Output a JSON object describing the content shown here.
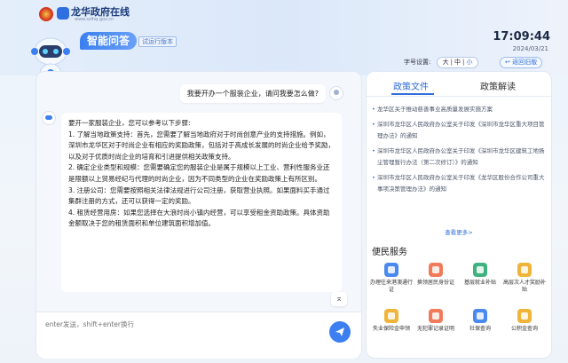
{
  "header": {
    "site_name": "龙华政府在线",
    "site_url": "www.szlhq.gov.cn",
    "app_title": "智能问答",
    "beta_tag": "试运行版本",
    "time": "17:09:44",
    "date": "2024/03/21",
    "font_size": {
      "label": "字号设置:",
      "options": [
        "大",
        "中",
        "小"
      ],
      "selected": "小"
    },
    "back_label": "↩ 返回旧版"
  },
  "chat": {
    "user_message": "我要开办一个服装企业，请问我要怎么做?",
    "bot_paragraphs": [
      "要开一家服装企业，您可以参考以下步骤:",
      "1. 了解当地政策支持：首先，您需要了解当地政府对于时尚创意产业的支持措施。例如，深圳市龙华区对于时尚企业有相应的奖励政策，包括对于高成长发展的时尚企业给予奖励，以及对于优质时尚企业的培育和引进提供相关政策支持。",
      "2. 确定企业类型和规模：您需要确定您的服装企业是属于规模以上工业、营利性服务业还是限额以上贸易经纪与代理的时尚企业，因为不同类型的企业在奖励政策上有所区别。",
      "3. 注册公司：您需要按照相关法律法规进行公司注册，获取营业执照。如果面料买手通过集群注册的方式，还可以获得一定的奖励。",
      "4. 租赁经营用房：如果您选择在大浪时尚小镇内经营，可以享受租金资助政策。具体资助金额取决于您的租赁面积和单位建筑面积增加值。"
    ],
    "input_placeholder": "enter发送，shift+enter换行"
  },
  "right_panel": {
    "tabs": [
      {
        "label": "政策文件",
        "active": true
      },
      {
        "label": "政策解读",
        "active": false
      }
    ],
    "policy_items": [
      "龙华区关于推动慈善事业高质量发展实施方案",
      "深圳市龙华区人民政府办公室关于印发《深圳市龙华区重大项目管理办法》的通知",
      "深圳市龙华区人民政府办公室关于印发《深圳市龙华区建筑工地扬尘管理暂行办法（第二次修订）》的通知",
      "深圳市龙华区人民政府办公室关于印发《龙华区股份合作公司重大事项决策管理办法》的通知"
    ],
    "more_link": "查看更多>",
    "services_title": "便民服务",
    "services": [
      {
        "label": "办理往来港澳通行证",
        "icon": "passport-icon",
        "color": "#4a8af0"
      },
      {
        "label": "换领居民身份证",
        "icon": "id-card-icon",
        "color": "#f07a5a"
      },
      {
        "label": "基层就业补贴",
        "icon": "employment-icon",
        "color": "#3fb27f"
      },
      {
        "label": "高层次人才奖励补贴",
        "icon": "talent-icon",
        "color": "#f0b43a"
      },
      {
        "label": "失业保险金申领",
        "icon": "insurance-icon",
        "color": "#f0b43a"
      },
      {
        "label": "无犯罪记录证明",
        "icon": "certificate-icon",
        "color": "#f07a5a"
      },
      {
        "label": "社保查询",
        "icon": "social-security-icon",
        "color": "#4a8af0"
      },
      {
        "label": "公积金查询",
        "icon": "housing-fund-icon",
        "color": "#f0b43a"
      }
    ]
  }
}
